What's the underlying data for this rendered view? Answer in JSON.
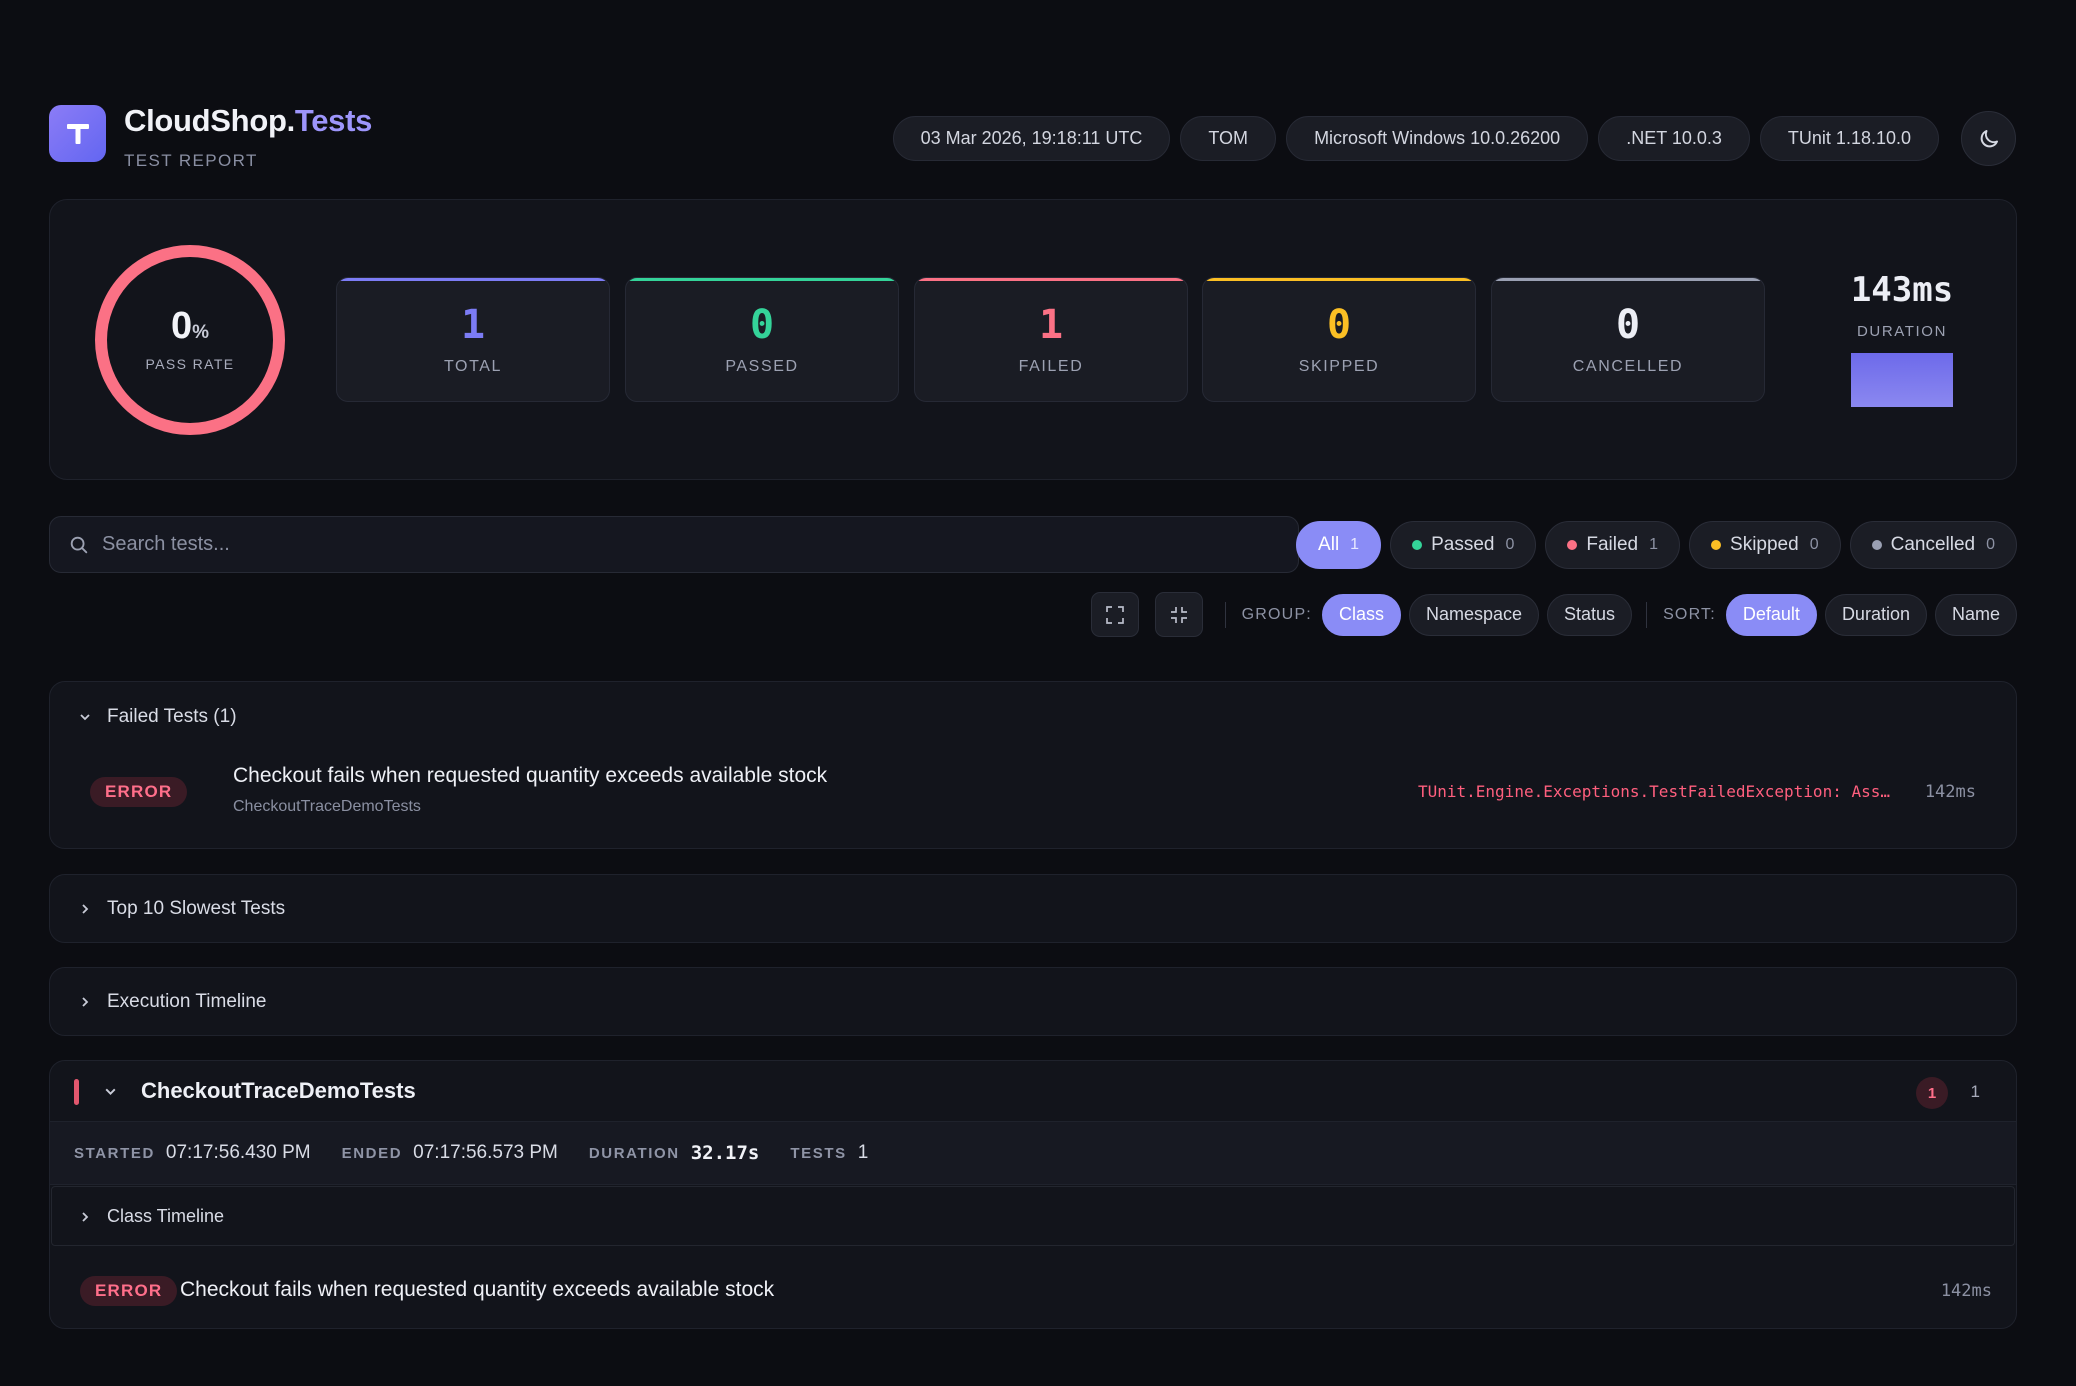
{
  "header": {
    "title_main": "CloudShop.",
    "title_accent": "Tests",
    "subtitle": "TEST REPORT",
    "logo_letter": "T",
    "meta_pills": [
      "03 Mar 2026, 19:18:11 UTC",
      "TOM",
      "Microsoft Windows 10.0.26200",
      ".NET 10.0.3",
      "TUnit 1.18.10.0"
    ],
    "theme_toggle_icon": "moon-icon"
  },
  "summary": {
    "pass_rate": {
      "value": "0",
      "unit": "%",
      "label": "PASS RATE",
      "fraction": 0
    },
    "stats": [
      {
        "value": "1",
        "label": "TOTAL",
        "color": "#7c7cf5"
      },
      {
        "value": "0",
        "label": "PASSED",
        "color": "#34d399"
      },
      {
        "value": "1",
        "label": "FAILED",
        "color": "#fb7185"
      },
      {
        "value": "0",
        "label": "SKIPPED",
        "color": "#fbbf24"
      },
      {
        "value": "0",
        "label": "CANCELLED",
        "color": "#9aa0b3"
      }
    ],
    "duration": {
      "value": "143ms",
      "label": "DURATION"
    }
  },
  "search": {
    "placeholder": "Search tests..."
  },
  "filters": [
    {
      "label": "All",
      "count": "1",
      "dot": null
    },
    {
      "label": "Passed",
      "count": "0",
      "dot": "#34d399"
    },
    {
      "label": "Failed",
      "count": "1",
      "dot": "#fb7185"
    },
    {
      "label": "Skipped",
      "count": "0",
      "dot": "#fbbf24"
    },
    {
      "label": "Cancelled",
      "count": "0",
      "dot": "#9aa0b3"
    }
  ],
  "toolbar": {
    "group_label": "GROUP:",
    "group_options": [
      "Class",
      "Namespace",
      "Status"
    ],
    "sort_label": "SORT:",
    "sort_options": [
      "Default",
      "Duration",
      "Name"
    ]
  },
  "failed_section": {
    "title": "Failed Tests (1)",
    "test": {
      "status": "ERROR",
      "name": "Checkout fails when requested quantity exceeds available stock",
      "class": "CheckoutTraceDemoTests",
      "exception": "TUnit.Engine.Exceptions.TestFailedException: Ass…",
      "duration": "142ms"
    }
  },
  "slowest_section": {
    "title": "Top 10 Slowest Tests"
  },
  "timeline_section": {
    "title": "Execution Timeline"
  },
  "class_group": {
    "name": "CheckoutTraceDemoTests",
    "failed_count": "1",
    "total_count": "1",
    "started_label": "STARTED",
    "started": "07:17:56.430 PM",
    "ended_label": "ENDED",
    "ended": "07:17:56.573 PM",
    "duration_label": "DURATION",
    "duration": "32.17s",
    "tests_label": "TESTS",
    "tests": "1",
    "timeline_title": "Class Timeline",
    "test": {
      "status": "ERROR",
      "name": "Checkout fails when requested quantity exceeds available stock",
      "duration": "142ms"
    }
  }
}
